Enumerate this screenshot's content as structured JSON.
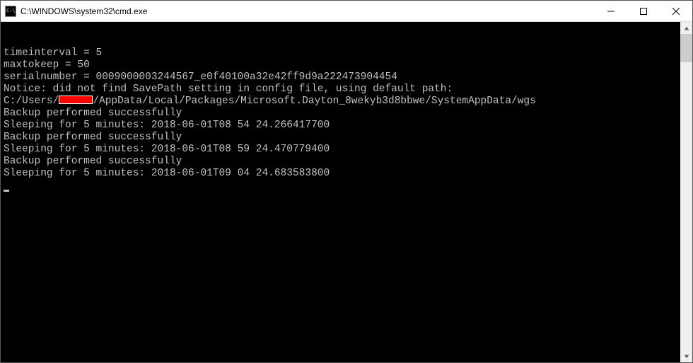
{
  "titlebar": {
    "title": "C:\\WINDOWS\\system32\\cmd.exe"
  },
  "terminal": {
    "lines": {
      "timeinterval": "timeinterval = 5",
      "maxtokeep": "maxtokeep = 50",
      "serialnumber": "serialnumber = 0009000003244567_e0f40100a32e42ff9d9a222473904454",
      "notice": "Notice: did not find SavePath setting in config file, using default path:",
      "path_prefix": "C:/Users/",
      "path_suffix": "/AppData/Local/Packages/Microsoft.Dayton_8wekyb3d8bbwe/SystemAppData/wgs",
      "backup1": "Backup performed successfully",
      "sleep1": "Sleeping for 5 minutes: 2018-06-01T08 54 24.266417700",
      "backup2": "Backup performed successfully",
      "sleep2": "Sleeping for 5 minutes: 2018-06-01T08 59 24.470779400",
      "backup3": "Backup performed successfully",
      "sleep3": "Sleeping for 5 minutes: 2018-06-01T09 04 24.683583800"
    }
  }
}
